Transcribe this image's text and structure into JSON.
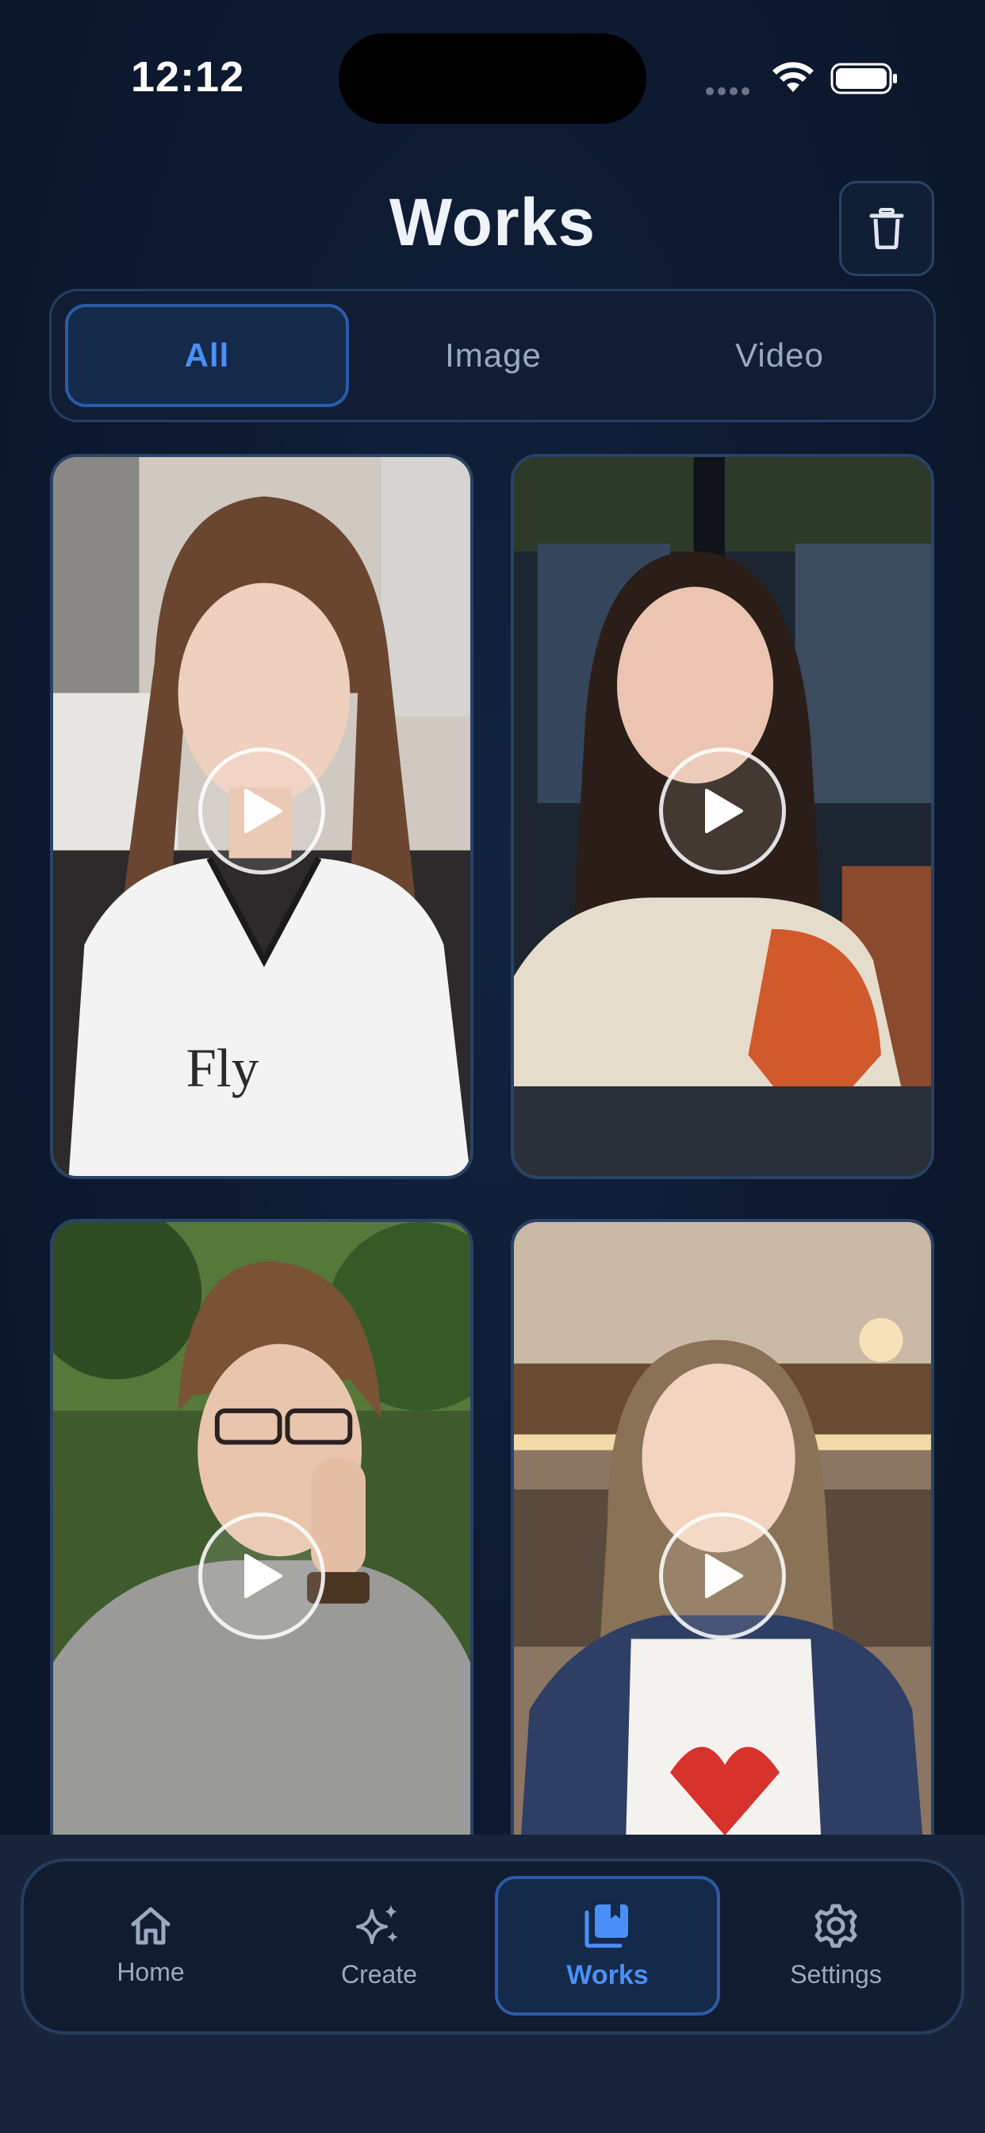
{
  "status_bar": {
    "time": "12:12"
  },
  "header": {
    "title": "Works"
  },
  "filter_tabs": [
    {
      "label": "All",
      "active": true
    },
    {
      "label": "Image",
      "active": false
    },
    {
      "label": "Video",
      "active": false
    }
  ],
  "works": [
    {
      "type": "video",
      "subject": "young woman with long brown hair in white football jersey, bathroom background"
    },
    {
      "type": "video",
      "subject": "young woman with long dark wavy hair, cream and orange sweater, evening window background"
    },
    {
      "type": "video",
      "subject": "young man with glasses, gray sweater, wristwatch, leafy background"
    },
    {
      "type": "video",
      "subject": "smiling young woman, denim jacket, heart t-shirt, restaurant background"
    }
  ],
  "bottom_nav": [
    {
      "label": "Home",
      "icon": "home-icon",
      "active": false
    },
    {
      "label": "Create",
      "icon": "sparkle-icon",
      "active": false
    },
    {
      "label": "Works",
      "icon": "library-icon",
      "active": true
    },
    {
      "label": "Settings",
      "icon": "gear-icon",
      "active": false
    }
  ],
  "colors": {
    "background": "#0c1628",
    "accent": "#4a8ff5",
    "border": "#2a4265",
    "inactive_text": "#9ba9bf"
  }
}
